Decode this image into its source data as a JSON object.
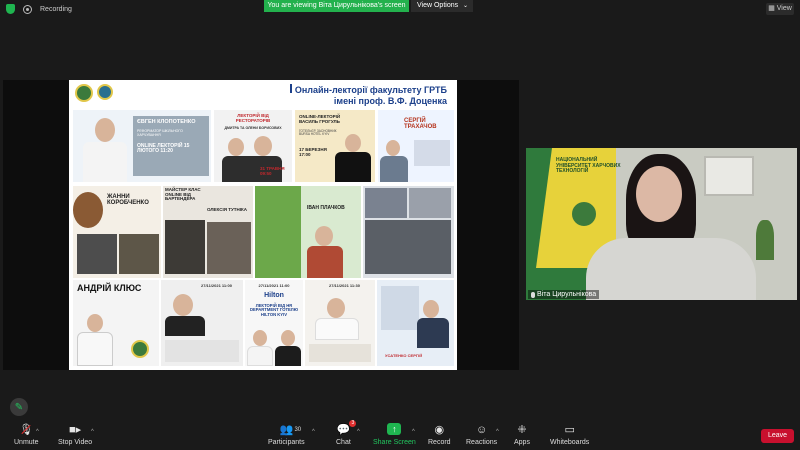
{
  "topbar": {
    "recording_label": "Recording",
    "viewing_banner": "You are viewing Віта Цирульнікова's screen",
    "view_options_label": "View Options",
    "view_button_label": "View"
  },
  "slide": {
    "title_line1": "Онлайн-лекторії факультету ГРТБ",
    "title_line2": "імені проф. В.Ф. Доценка",
    "cards": {
      "klopotenko_name": "ЄВГЕН КЛОПОТЕНКО",
      "klopotenko_role": "РЕФОРМАТОР ШКІЛЬНОГО ХАРЧУВАННЯ",
      "klopotenko_date": "ONLINE ЛЕКТОРІЙ 15 ЛЮТОГО 11:20",
      "restorators_title": "ЛЕКТОРІЙ ВІД РЕСТОРАТОРІВ",
      "restorators_names": "ДМИТРА ТА ОЛЕНИ БОРИСОВИХ",
      "restorators_date": "31 ТРАВНЯ 09:50",
      "grogul_title": "ONLINE-ЛЕКТОРІЙ ВАСИЛЬ ГРОГУЛЬ",
      "grogul_role": "ГОТЕЛЬЄР, ЗАСНОВНИК BURSA HOTEL KYIV",
      "grogul_date": "17 БЕРЕЗНЯ 17:00",
      "trakhachov_name": "СЕРГІЙ ТРАХАЧОВ",
      "korobchenko_name": "ЖАННИ КОРОБЧЕНКО",
      "korobchenko_title": "МАЙСТЕР КЛАС ONLINE ВІД БАРТЕНДЕРА",
      "tutnik_name": "ОЛЕКСІЯ ТУТНІКА",
      "plachkov_name": "ІВАН ПЛАЧКОВ",
      "klyus_name": "АНДРІЙ КЛЮС",
      "klyus_date": "27/11/2021 11:00",
      "hilton_logo": "Hilton",
      "hilton_title": "ЛЕКТОРІЙ ВІД HR DEPARTMENT ГОТЕЛЮ HILTON KYIV",
      "hilton_date": "27/11/2021 11:00",
      "chef_date": "27/11/2021 11:30",
      "usatenko_name": "УСАТЕНКО СЕРГІЙ"
    }
  },
  "webcam": {
    "participant_name": "Віта Цирульнікова",
    "wall_text": "НАЦІОНАЛЬНИЙ УНІВЕРСИТЕТ ХАРЧОВИХ ТЕХНОЛОГІЙ"
  },
  "toolbar": {
    "unmute_label": "Unmute",
    "stop_video_label": "Stop Video",
    "participants_label": "Participants",
    "participants_count": "30",
    "chat_label": "Chat",
    "chat_badge": "3",
    "share_screen_label": "Share Screen",
    "record_label": "Record",
    "reactions_label": "Reactions",
    "apps_label": "Apps",
    "whiteboards_label": "Whiteboards",
    "leave_label": "Leave"
  },
  "colors": {
    "zoom_green": "#23b14d",
    "leave_red": "#c8102e",
    "slide_title_blue": "#1b3f8a"
  }
}
